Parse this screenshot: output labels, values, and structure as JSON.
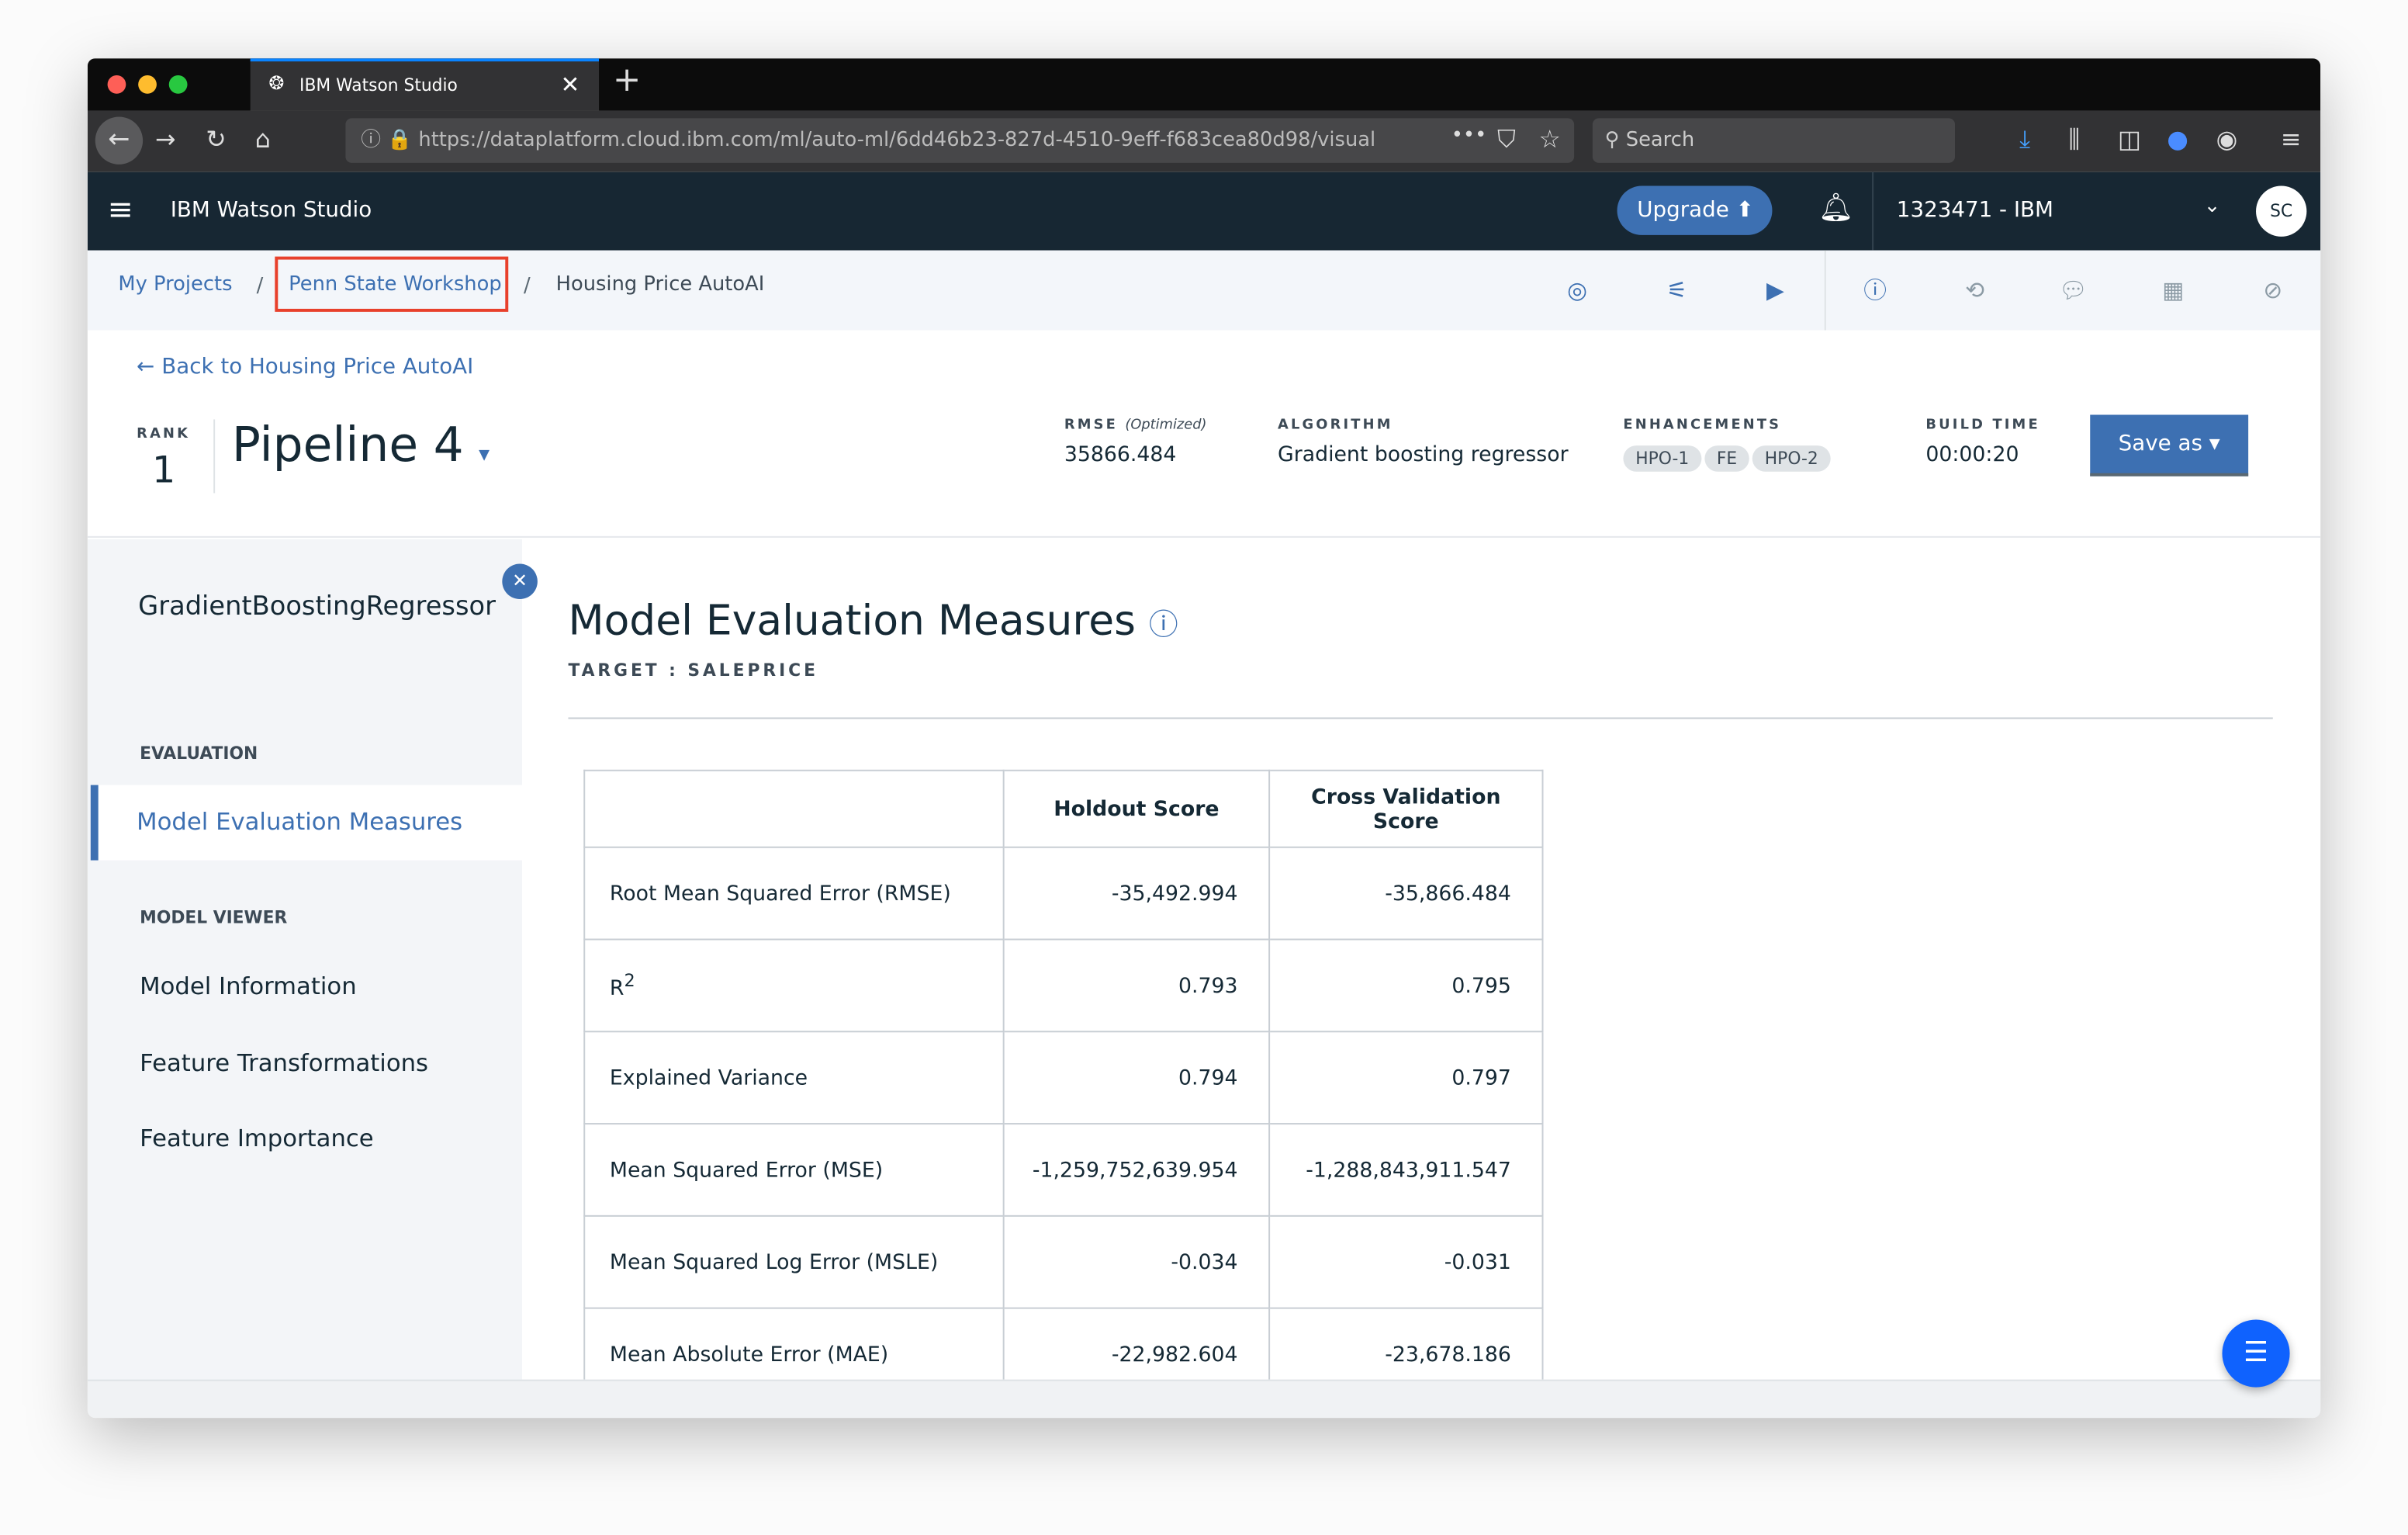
{
  "browser": {
    "tab_title": "IBM Watson Studio",
    "url": "https://dataplatform.cloud.ibm.com/ml/auto-ml/6dd46b23-827d-4510-9eff-f683cea80d98/visual",
    "search_placeholder": "Search"
  },
  "app": {
    "brand": "IBM Watson Studio",
    "upgrade_label": "Upgrade",
    "account": "1323471 - IBM",
    "avatar": "SC"
  },
  "breadcrumb": {
    "items": [
      "My Projects",
      "Penn State Workshop",
      "Housing Price AutoAI"
    ],
    "separator": "/"
  },
  "header": {
    "back_label": "Back to Housing Price AutoAI",
    "rank_label": "RANK",
    "rank": "1",
    "pipeline": "Pipeline 4",
    "rmse_label": "RMSE",
    "rmse_qualifier": "(Optimized)",
    "rmse_value": "35866.484",
    "algorithm_label": "ALGORITHM",
    "algorithm": "Gradient boosting regressor",
    "enhancements_label": "ENHANCEMENTS",
    "enhancements": [
      "HPO-1",
      "FE",
      "HPO-2"
    ],
    "build_label": "BUILD TIME",
    "build_time": "00:00:20",
    "save_label": "Save as"
  },
  "sidebar": {
    "title": "GradientBoostingRegressor",
    "evaluation_header": "EVALUATION",
    "evaluation_item": "Model Evaluation Measures",
    "viewer_header": "MODEL VIEWER",
    "viewer_items": [
      "Model Information",
      "Feature Transformations",
      "Feature Importance"
    ]
  },
  "main": {
    "title": "Model Evaluation Measures",
    "target": "TARGET : SALEPRICE",
    "columns": [
      "",
      "Holdout Score",
      "Cross Validation Score"
    ],
    "rows": [
      [
        "Root Mean Squared Error (RMSE)",
        "-35,492.994",
        "-35,866.484"
      ],
      [
        "R",
        "0.793",
        "0.795"
      ],
      [
        "Explained Variance",
        "0.794",
        "0.797"
      ],
      [
        "Mean Squared Error (MSE)",
        "-1,259,752,639.954",
        "-1,288,843,911.547"
      ],
      [
        "Mean Squared Log Error (MSLE)",
        "-0.034",
        "-0.031"
      ],
      [
        "Mean Absolute Error (MAE)",
        "-22,982.604",
        "-23,678.186"
      ]
    ],
    "r2_superscript": "2"
  },
  "colors": {
    "accent": "#3d70b2",
    "header_bg": "#172733",
    "highlight_box": "#e8402b",
    "chat": "#0f62fe"
  }
}
